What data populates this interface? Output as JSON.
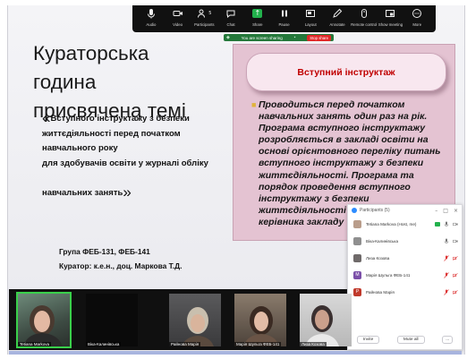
{
  "toolbar": {
    "items": [
      {
        "label": "Audio",
        "icon": "microphone-icon"
      },
      {
        "label": "Video",
        "icon": "video-camera-icon"
      },
      {
        "label": "Participants",
        "icon": "participants-icon",
        "count": "5"
      },
      {
        "label": "Chat",
        "icon": "chat-icon"
      },
      {
        "label": "Share",
        "icon": "share-screen-icon"
      },
      {
        "label": "Pause",
        "icon": "pause-icon"
      },
      {
        "label": "Layout",
        "icon": "layout-icon"
      },
      {
        "label": "Annotate",
        "icon": "annotate-pen-icon"
      },
      {
        "label": "Remote control",
        "icon": "remote-control-icon"
      },
      {
        "label": "Show meeting",
        "icon": "show-meeting-icon"
      },
      {
        "label": "More",
        "icon": "more-icon"
      }
    ]
  },
  "sharing_bar": {
    "text": "You are screen sharing",
    "stop_label": "Stop share"
  },
  "slide": {
    "title_line1": "Кураторська година",
    "title_line2": "присвячена темі",
    "open_quote": "«",
    "close_quote": "»",
    "subtitle_line1": "Вступного інструктажу з безпеки",
    "subtitle_line2": "життєдіяльності перед початком",
    "subtitle_line3": "навчального року",
    "subtitle_line4": "для здобувачів освіти у журналі обліку",
    "subtitle_line5": "навчальних занять",
    "group_line": "Група ФЕБ-131, ФЕБ-141",
    "curator_line": "Куратор: к.е.н., доц. Маркова Т.Д."
  },
  "panel": {
    "heading": "Вступний інструктаж",
    "body": "Проводиться перед початком навчальних занять один раз на рік. Програма вступного інструктажу розробляється в закладі освіти на основі орієнтовного переліку питань вступного інструктажу з безпеки життєдіяльності. Програма та порядок проведення вступного інструктажу з безпеки життєдіяльності затверджується керівника закладу"
  },
  "participants_panel": {
    "title": "Participants (5)",
    "participants": [
      {
        "name": "Tetiana Markova (Host, me)",
        "avatar_color": "#b99d8b"
      },
      {
        "name": "Віка-Калинівська",
        "avatar_color": "#8f8f8f"
      },
      {
        "name": "Лиза Козова",
        "avatar_color": "#6f6a6a"
      },
      {
        "name": "Марія Шульга ФЕБ-141",
        "avatar_color": "#7b4fa8"
      },
      {
        "name": "Райнова Марія",
        "avatar_color": "#c0392b"
      }
    ],
    "initials": [
      "",
      "",
      "",
      "М",
      "Р"
    ],
    "invite_label": "Invite",
    "mute_all_label": "Mute all",
    "more_label": "..."
  },
  "video_tiles": [
    {
      "name": "Tetiana Markova"
    },
    {
      "name": "Віка-Калинівська"
    },
    {
      "name": "Райнова Марія"
    },
    {
      "name": "Марія Шульга ФЕБ-141"
    },
    {
      "name": "Лиза Козова"
    }
  ],
  "colors": {
    "panel_pink": "#e4c3d2",
    "panel_heading": "#c00000",
    "share_green": "#24783a",
    "stop_red": "#e02828"
  }
}
